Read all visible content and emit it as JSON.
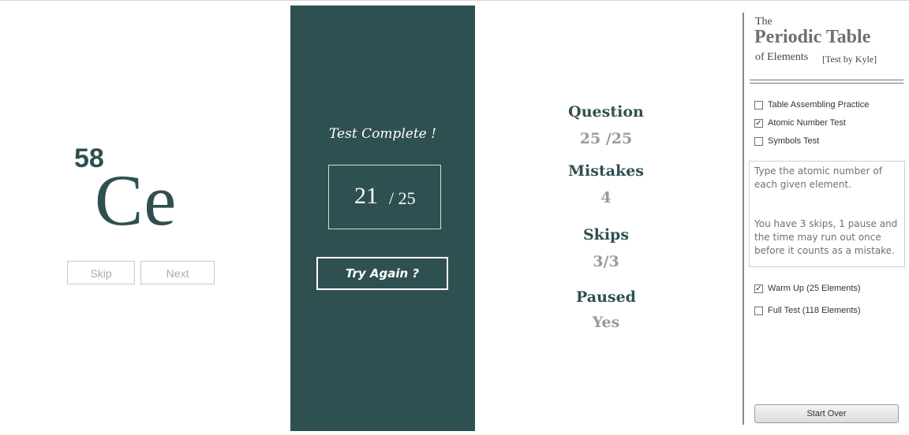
{
  "element": {
    "atomic_number": "58",
    "symbol": "Ce"
  },
  "controls": {
    "skip_label": "Skip",
    "next_label": "Next"
  },
  "result": {
    "heading": "Test Complete !",
    "score": "21",
    "total": "/ 25",
    "try_again_label": "Try Again ?"
  },
  "stats": {
    "question_label": "Question",
    "question_value": "25 /25",
    "mistakes_label": "Mistakes",
    "mistakes_value": "4",
    "skips_label": "Skips",
    "skips_value": "3/3",
    "paused_label": "Paused",
    "paused_value": "Yes"
  },
  "sidebar": {
    "title_the": "The",
    "title_main": "Periodic Table",
    "title_sub": "of Elements",
    "author": "[Test by Kyle]",
    "modes": [
      {
        "label": "Table Assembling Practice",
        "checked": false
      },
      {
        "label": "Atomic Number Test",
        "checked": true
      },
      {
        "label": "Symbols Test",
        "checked": false
      }
    ],
    "description_1": "Type the atomic number of each given element.",
    "description_2": "You have 3 skips, 1 pause and the time may run out once before it counts as a mistake.",
    "lengths": [
      {
        "label": "Warm Up (25 Elements)",
        "checked": true
      },
      {
        "label": "Full Test (118 Elements)",
        "checked": false
      }
    ],
    "start_over_label": "Start Over"
  },
  "colors": {
    "accent": "#2f5050",
    "muted": "#9a9a9a"
  }
}
